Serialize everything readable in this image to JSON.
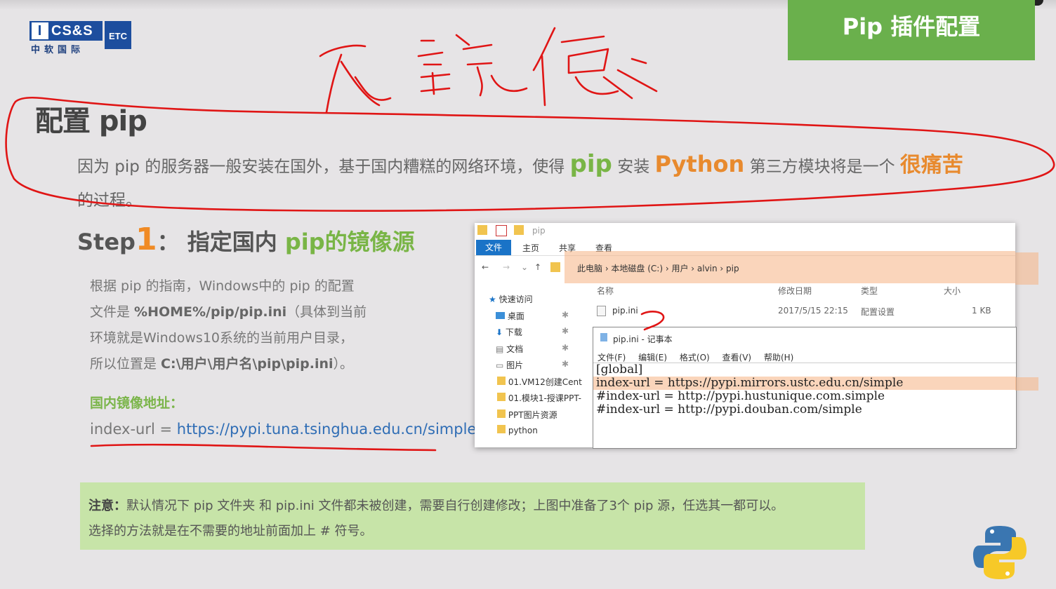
{
  "slide": {
    "header_title": "Pip 插件配置",
    "logo": {
      "brand": "CS&S",
      "tag": "ETC",
      "sub": "中软国际"
    },
    "handwriting": "改镜像",
    "section_title": "配置 pip",
    "intro": {
      "part1": "因为 pip 的服务器一般安装在国外，基于国内糟糕的网络环境，使得",
      "pip": "pip",
      "install": "安装",
      "python": "Python",
      "part2": "第三方模块将是一个",
      "hard": "很痛苦",
      "part3": "的过程。"
    },
    "step": {
      "prefix": "Step",
      "num": "1",
      "sep": "：",
      "label1": "指定国内",
      "label2": "pip的镜像源"
    },
    "guide": {
      "l1": "根据 pip 的指南，Windows中的  pip 的配置",
      "l2a": "文件是 ",
      "l2b": "%HOME%/pip/pip.ini",
      "l2c": "（具体到当前",
      "l3": "环境就是Windows10系统的当前用户目录，",
      "l4a": "所以位置是 ",
      "l4b": "C:\\用户\\用户名\\pip\\pip.ini",
      "l4c": "）。"
    },
    "mirror_label": "国内镜像地址：",
    "mirror_prefix": "index-url  =  ",
    "mirror_url": "https://pypi.tuna.tsinghua.edu.cn/simple",
    "note": {
      "bold": "注意：",
      "l1": "默认情况下 pip 文件夹 和 pip.ini 文件都未被创建，需要自行创建修改；上图中准备了3个 pip 源，任选其一都可以。",
      "l2": "选择的方法就是在不需要的地址前面加上 # 符号。"
    }
  },
  "explorer": {
    "title": "pip",
    "ribbon": [
      "文件",
      "主页",
      "共享",
      "查看"
    ],
    "crumbs": "此电脑  ›  本地磁盘 (C:)  ›  用户  ›  alvin  ›  pip",
    "columns": [
      "名称",
      "修改日期",
      "类型",
      "大小"
    ],
    "sidebar": [
      "快速访问",
      "桌面",
      "下载",
      "文档",
      "图片",
      "01.VM12创建Cent",
      "01.模块1-授课PPT-",
      "PPT图片资源",
      "python"
    ],
    "file": {
      "name": "pip.ini",
      "date": "2017/5/15 22:15",
      "type": "配置设置",
      "size": "1 KB"
    }
  },
  "notepad": {
    "title": "pip.ini - 记事本",
    "menu": [
      "文件(F)",
      "编辑(E)",
      "格式(O)",
      "查看(V)",
      "帮助(H)"
    ],
    "lines": [
      "[global]",
      "index-url = https://pypi.mirrors.ustc.edu.cn/simple",
      "#index-url = http://pypi.hustunique.com.simple",
      "#index-url = http://pypi.douban.com/simple"
    ]
  },
  "colors": {
    "green_accent": "#6ab04c",
    "orange_accent": "#e88a2e",
    "ink_red": "#e01515",
    "win_blue": "#1a73c7"
  }
}
